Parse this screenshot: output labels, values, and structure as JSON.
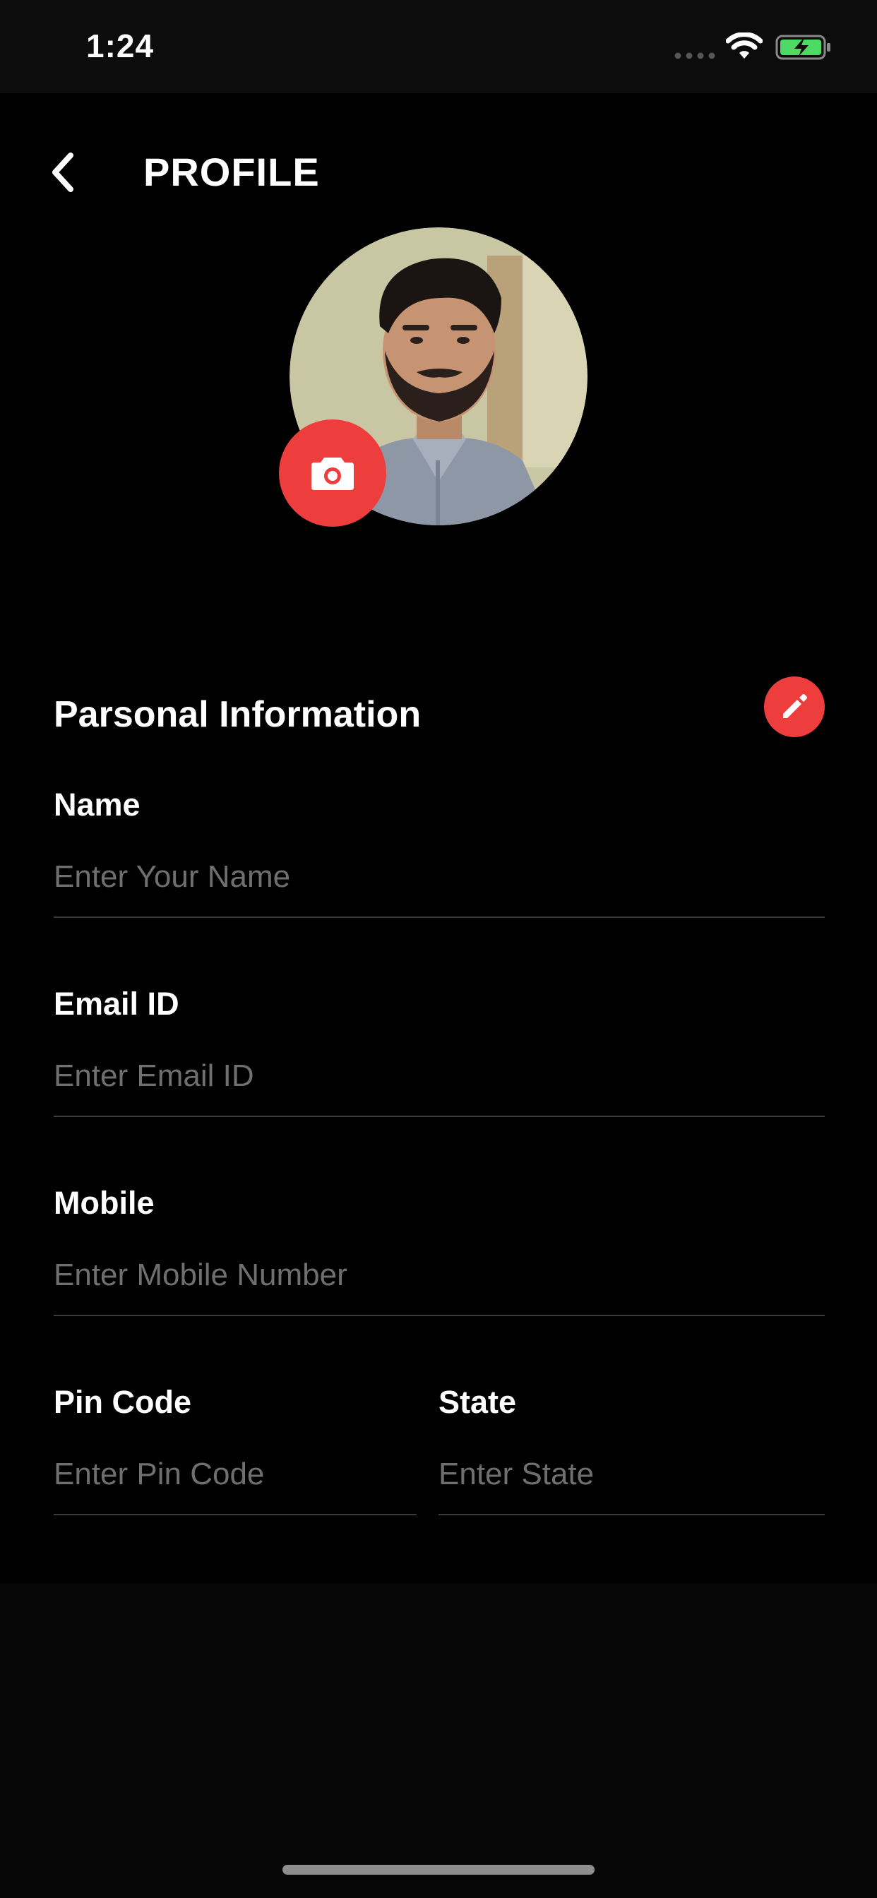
{
  "status_bar": {
    "time": "1:24",
    "icons": [
      "cellular-signal-icon",
      "wifi-icon",
      "battery-charging-icon"
    ],
    "battery_color": "#4cd964"
  },
  "header": {
    "title": "PROFILE",
    "back_icon": "chevron-left-icon"
  },
  "profile": {
    "avatar": "profile-photo",
    "camera_icon": "camera-icon"
  },
  "section": {
    "title": "Parsonal Information",
    "edit_icon": "pencil-icon"
  },
  "fields": {
    "name": {
      "label": "Name",
      "placeholder": "Enter Your Name",
      "value": ""
    },
    "email": {
      "label": "Email ID",
      "placeholder": "Enter Email ID",
      "value": ""
    },
    "mobile": {
      "label": "Mobile",
      "placeholder": "Enter Mobile Number",
      "value": ""
    },
    "pincode": {
      "label": "Pin Code",
      "placeholder": "Enter Pin Code",
      "value": ""
    },
    "state": {
      "label": "State",
      "placeholder": "Enter State",
      "value": ""
    }
  },
  "colors": {
    "accent": "#ee3d3d",
    "background": "#000000",
    "placeholder": "#6f6f6f",
    "divider": "#3a3a3a"
  }
}
